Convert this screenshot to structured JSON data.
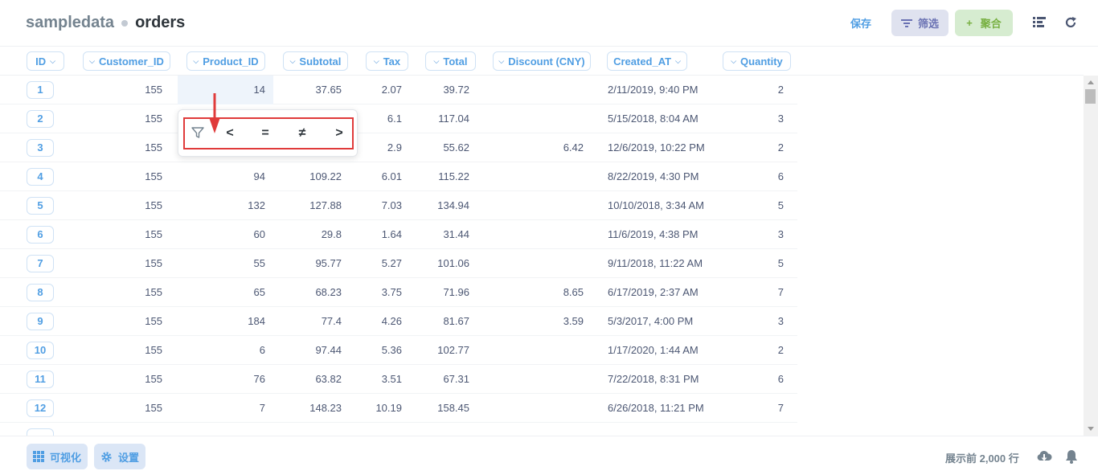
{
  "header": {
    "database": "sampledata",
    "table": "orders",
    "save_label": "保存",
    "filter_label": "筛选",
    "summarize_label": "聚合",
    "icons": [
      "filter-icon",
      "plus-icon",
      "list-icon",
      "refresh-icon"
    ]
  },
  "columns": [
    "ID",
    "Customer_ID",
    "Product_ID",
    "Subtotal",
    "Tax",
    "Total",
    "Discount (CNY)",
    "Created_AT",
    "Quantity"
  ],
  "rows": [
    {
      "id": "1",
      "customer_id": "155",
      "product_id": "14",
      "subtotal": "37.65",
      "tax": "2.07",
      "total": "39.72",
      "discount": "",
      "created_at": "2/11/2019, 9:40 PM",
      "quantity": "2"
    },
    {
      "id": "2",
      "customer_id": "155",
      "product_id": "",
      "subtotal": "",
      "tax": "6.1",
      "total": "117.04",
      "discount": "",
      "created_at": "5/15/2018, 8:04 AM",
      "quantity": "3"
    },
    {
      "id": "3",
      "customer_id": "155",
      "product_id": "",
      "subtotal": "",
      "tax": "2.9",
      "total": "55.62",
      "discount": "6.42",
      "created_at": "12/6/2019, 10:22 PM",
      "quantity": "2"
    },
    {
      "id": "4",
      "customer_id": "155",
      "product_id": "94",
      "subtotal": "109.22",
      "tax": "6.01",
      "total": "115.22",
      "discount": "",
      "created_at": "8/22/2019, 4:30 PM",
      "quantity": "6"
    },
    {
      "id": "5",
      "customer_id": "155",
      "product_id": "132",
      "subtotal": "127.88",
      "tax": "7.03",
      "total": "134.94",
      "discount": "",
      "created_at": "10/10/2018, 3:34 AM",
      "quantity": "5"
    },
    {
      "id": "6",
      "customer_id": "155",
      "product_id": "60",
      "subtotal": "29.8",
      "tax": "1.64",
      "total": "31.44",
      "discount": "",
      "created_at": "11/6/2019, 4:38 PM",
      "quantity": "3"
    },
    {
      "id": "7",
      "customer_id": "155",
      "product_id": "55",
      "subtotal": "95.77",
      "tax": "5.27",
      "total": "101.06",
      "discount": "",
      "created_at": "9/11/2018, 11:22 AM",
      "quantity": "5"
    },
    {
      "id": "8",
      "customer_id": "155",
      "product_id": "65",
      "subtotal": "68.23",
      "tax": "3.75",
      "total": "71.96",
      "discount": "8.65",
      "created_at": "6/17/2019, 2:37 AM",
      "quantity": "7"
    },
    {
      "id": "9",
      "customer_id": "155",
      "product_id": "184",
      "subtotal": "77.4",
      "tax": "4.26",
      "total": "81.67",
      "discount": "3.59",
      "created_at": "5/3/2017, 4:00 PM",
      "quantity": "3"
    },
    {
      "id": "10",
      "customer_id": "155",
      "product_id": "6",
      "subtotal": "97.44",
      "tax": "5.36",
      "total": "102.77",
      "discount": "",
      "created_at": "1/17/2020, 1:44 AM",
      "quantity": "2"
    },
    {
      "id": "11",
      "customer_id": "155",
      "product_id": "76",
      "subtotal": "63.82",
      "tax": "3.51",
      "total": "67.31",
      "discount": "",
      "created_at": "7/22/2018, 8:31 PM",
      "quantity": "6"
    },
    {
      "id": "12",
      "customer_id": "155",
      "product_id": "7",
      "subtotal": "148.23",
      "tax": "10.19",
      "total": "158.45",
      "discount": "",
      "created_at": "6/26/2018, 11:21 PM",
      "quantity": "7"
    }
  ],
  "popover": {
    "operators": [
      "<",
      "=",
      "≠",
      ">"
    ]
  },
  "footer": {
    "visualize_label": "可视化",
    "settings_label": "设置",
    "row_count": "展示前 2,000 行"
  },
  "colors": {
    "brand": "#509ee3",
    "filter_bg": "#dfe2ef",
    "summarize_bg": "#d6ecd0",
    "highlight": "#e03b3b"
  }
}
